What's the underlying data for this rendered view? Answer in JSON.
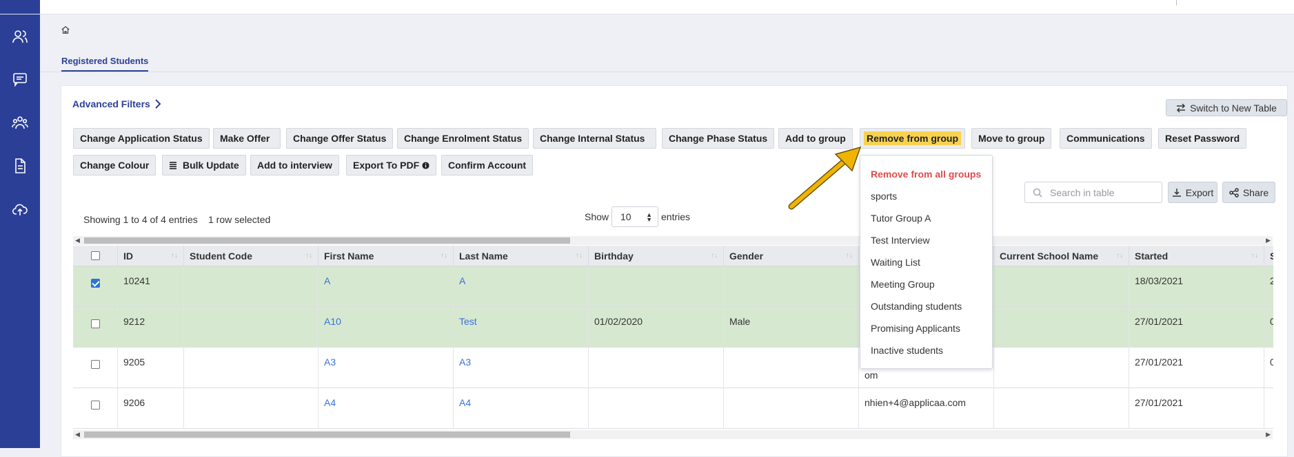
{
  "tab": {
    "label": "Registered Students"
  },
  "filters": {
    "advanced_label": "Advanced Filters"
  },
  "switch_table": {
    "label": "Switch to New Table"
  },
  "actions_row1": [
    "Change Application Status",
    "Make Offer",
    "Change Offer Status",
    "Change Enrolment Status",
    "Change Internal Status",
    "Change Phase Status",
    "Add to group",
    "Remove from group",
    "Move to group",
    "Communications",
    "Reset Password"
  ],
  "actions_row2": [
    "Change Colour",
    "Bulk Update",
    "Add to interview",
    "Export To PDF",
    "Confirm Account"
  ],
  "dropdown": {
    "items": [
      "Remove from all groups",
      "sports",
      "Tutor Group A",
      "Test Interview",
      "Waiting List",
      "Meeting Group",
      "Outstanding students",
      "Promising Applicants",
      "Inactive students"
    ]
  },
  "info": {
    "showing": "Showing 1 to 4 of 4 entries",
    "selected": "1 row selected",
    "show_label": "Show",
    "page_size": "10",
    "entries_label": "entries"
  },
  "search": {
    "placeholder": "Search in table"
  },
  "toolbar": {
    "export_label": "Export",
    "share_label": "Share"
  },
  "table": {
    "columns": [
      "ID",
      "Student Code",
      "First Name",
      "Last Name",
      "Birthday",
      "Gender",
      "",
      "Current School Name",
      "Started",
      "S"
    ],
    "rows": [
      {
        "checked": true,
        "id": "10241",
        "code": "",
        "first": "A",
        "last": "A",
        "birthday": "",
        "gender": "",
        "email": "",
        "school": "",
        "started": "18/03/2021",
        "s": "2"
      },
      {
        "checked": false,
        "id": "9212",
        "code": "",
        "first": "A10",
        "last": "Test",
        "birthday": "01/02/2020",
        "gender": "Male",
        "email": "",
        "school": "",
        "started": "27/01/2021",
        "s": "0"
      },
      {
        "checked": false,
        "id": "9205",
        "code": "",
        "first": "A3",
        "last": "A3",
        "birthday": "",
        "gender": "",
        "email": "om",
        "school": "",
        "started": "27/01/2021",
        "s": "0"
      },
      {
        "checked": false,
        "id": "9206",
        "code": "",
        "first": "A4",
        "last": "A4",
        "birthday": "",
        "gender": "",
        "email": "nhien+4@applicaa.com",
        "school": "",
        "started": "27/01/2021",
        "s": ""
      }
    ]
  }
}
